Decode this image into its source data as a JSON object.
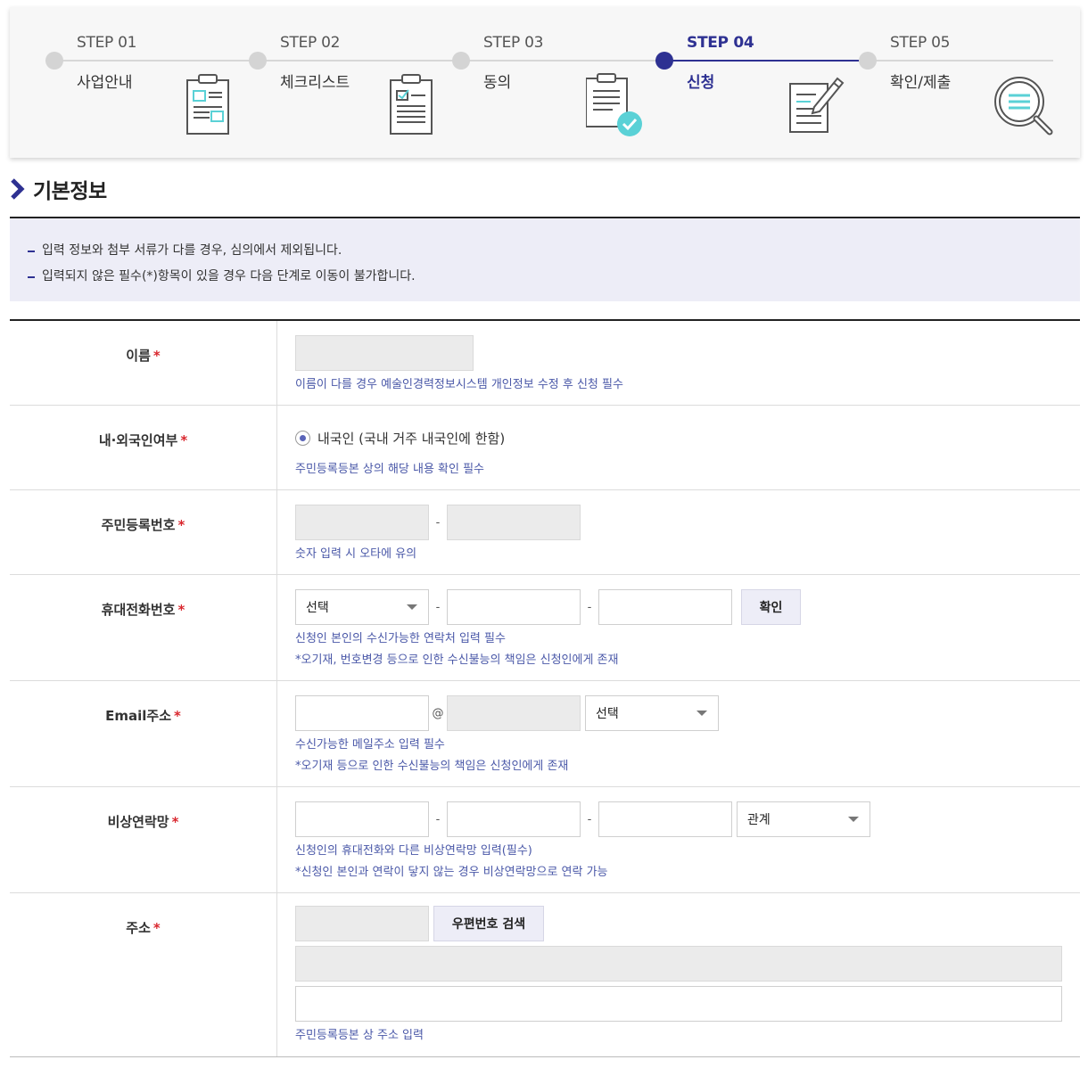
{
  "steps": [
    {
      "num": "STEP 01",
      "name": "사업안내",
      "icon": "clipboard-icon"
    },
    {
      "num": "STEP 02",
      "name": "체크리스트",
      "icon": "checklist-icon"
    },
    {
      "num": "STEP 03",
      "name": "동의",
      "icon": "document-check-icon"
    },
    {
      "num": "STEP 04",
      "name": "신청",
      "icon": "document-pen-icon",
      "active": true
    },
    {
      "num": "STEP 05",
      "name": "확인/제출",
      "icon": "magnifier-icon"
    }
  ],
  "section": {
    "title": "기본정보"
  },
  "notice": [
    "입력 정보와 첨부 서류가 다를 경우, 심의에서 제외됩니다.",
    "입력되지 않은 필수(*)항목이 있을 경우 다음 단계로 이동이 불가합니다."
  ],
  "required_mark": "*",
  "form": {
    "name": {
      "label": "이름",
      "hint": "이름이 다를 경우 예술인경력정보시스템 개인정보 수정 후 신청 필수"
    },
    "nationality": {
      "label": "내·외국인여부",
      "option": "내국인 (국내 거주 내국인에 한함)",
      "hint": "주민등록등본 상의 해당 내용 확인 필수"
    },
    "resident_no": {
      "label": "주민등록번호",
      "sep": "-",
      "hint": "숫자 입력 시 오타에 유의"
    },
    "phone": {
      "label": "휴대전화번호",
      "select": "선택",
      "sep": "-",
      "button": "확인",
      "hints": [
        "신청인 본인의 수신가능한 연락처 입력 필수",
        "*오기재, 번호변경 등으로 인한 수신불능의 책임은 신청인에게 존재"
      ]
    },
    "email": {
      "label": "Email주소",
      "at": "@",
      "select": "선택",
      "hints": [
        "수신가능한 메일주소 입력 필수",
        "*오기재 등으로 인한 수신불능의 책임은 신청인에게 존재"
      ]
    },
    "emergency": {
      "label": "비상연락망",
      "sep": "-",
      "select": "관계",
      "hints": [
        "신청인의 휴대전화와 다른 비상연락망 입력(필수)",
        "*신청인 본인과 연락이 닿지 않는 경우 비상연락망으로 연락 가능"
      ]
    },
    "address": {
      "label": "주소",
      "button": "우편번호 검색",
      "hint": "주민등록등본 상 주소 입력"
    }
  },
  "colors": {
    "accent": "#2e3192",
    "hint": "#4a58a8",
    "required": "#d9272e",
    "notice_bg": "#ededf7"
  }
}
